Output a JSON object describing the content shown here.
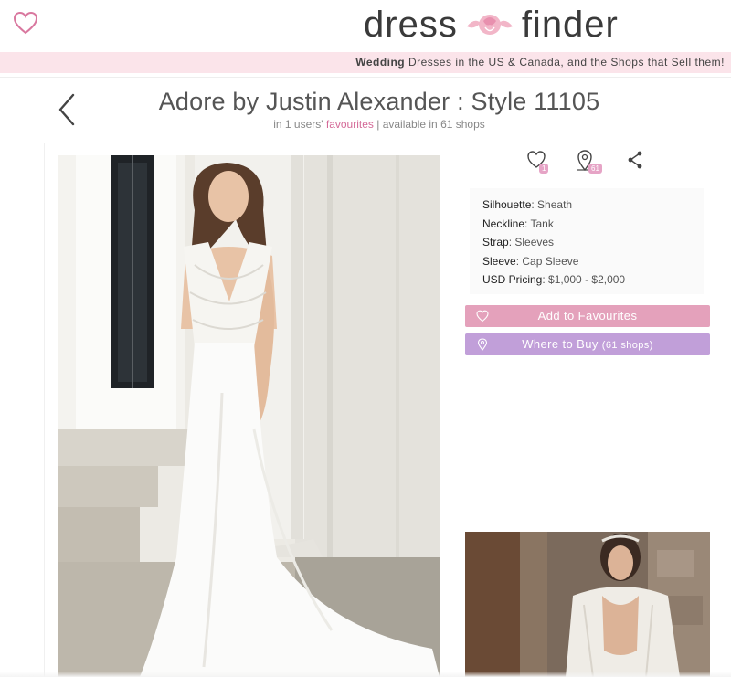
{
  "header": {
    "brand_left": "dress",
    "brand_right": "finder",
    "tagline_bold": "Wedding",
    "tagline_rest": " Dresses in the US & Canada, and the Shops that Sell them!"
  },
  "dress": {
    "title": "Adore by Justin Alexander : Style 11105",
    "subtitle_prefix": "in 1 users' ",
    "subtitle_link": "favourites",
    "subtitle_suffix": " | available in 61 shops"
  },
  "stats": {
    "favourites_count": "1",
    "shops_count": "61"
  },
  "details": [
    {
      "label": "Silhouette",
      "value": "Sheath"
    },
    {
      "label": "Neckline",
      "value": "Tank"
    },
    {
      "label": "Strap",
      "value": "Sleeves"
    },
    {
      "label": "Sleeve",
      "value": "Cap Sleeve"
    },
    {
      "label": "USD Pricing",
      "value": "$1,000 - $2,000"
    }
  ],
  "buttons": {
    "add_favourites": "Add to Favourites",
    "where_to_buy": "Where to Buy",
    "where_to_buy_count": "(61 shops)"
  },
  "icons": {
    "logo": "heart-outline-icon",
    "back": "chevron-left-icon",
    "favourites": "heart-outline-icon",
    "shops": "map-pin-icon",
    "share": "share-icon"
  },
  "colors": {
    "tagline_bg": "#fbe4ea",
    "favourites_button": "#e4a1bb",
    "where_to_buy_button": "#c19fd9",
    "link_pink": "#d46a98",
    "badge": "#e6a4c6"
  }
}
